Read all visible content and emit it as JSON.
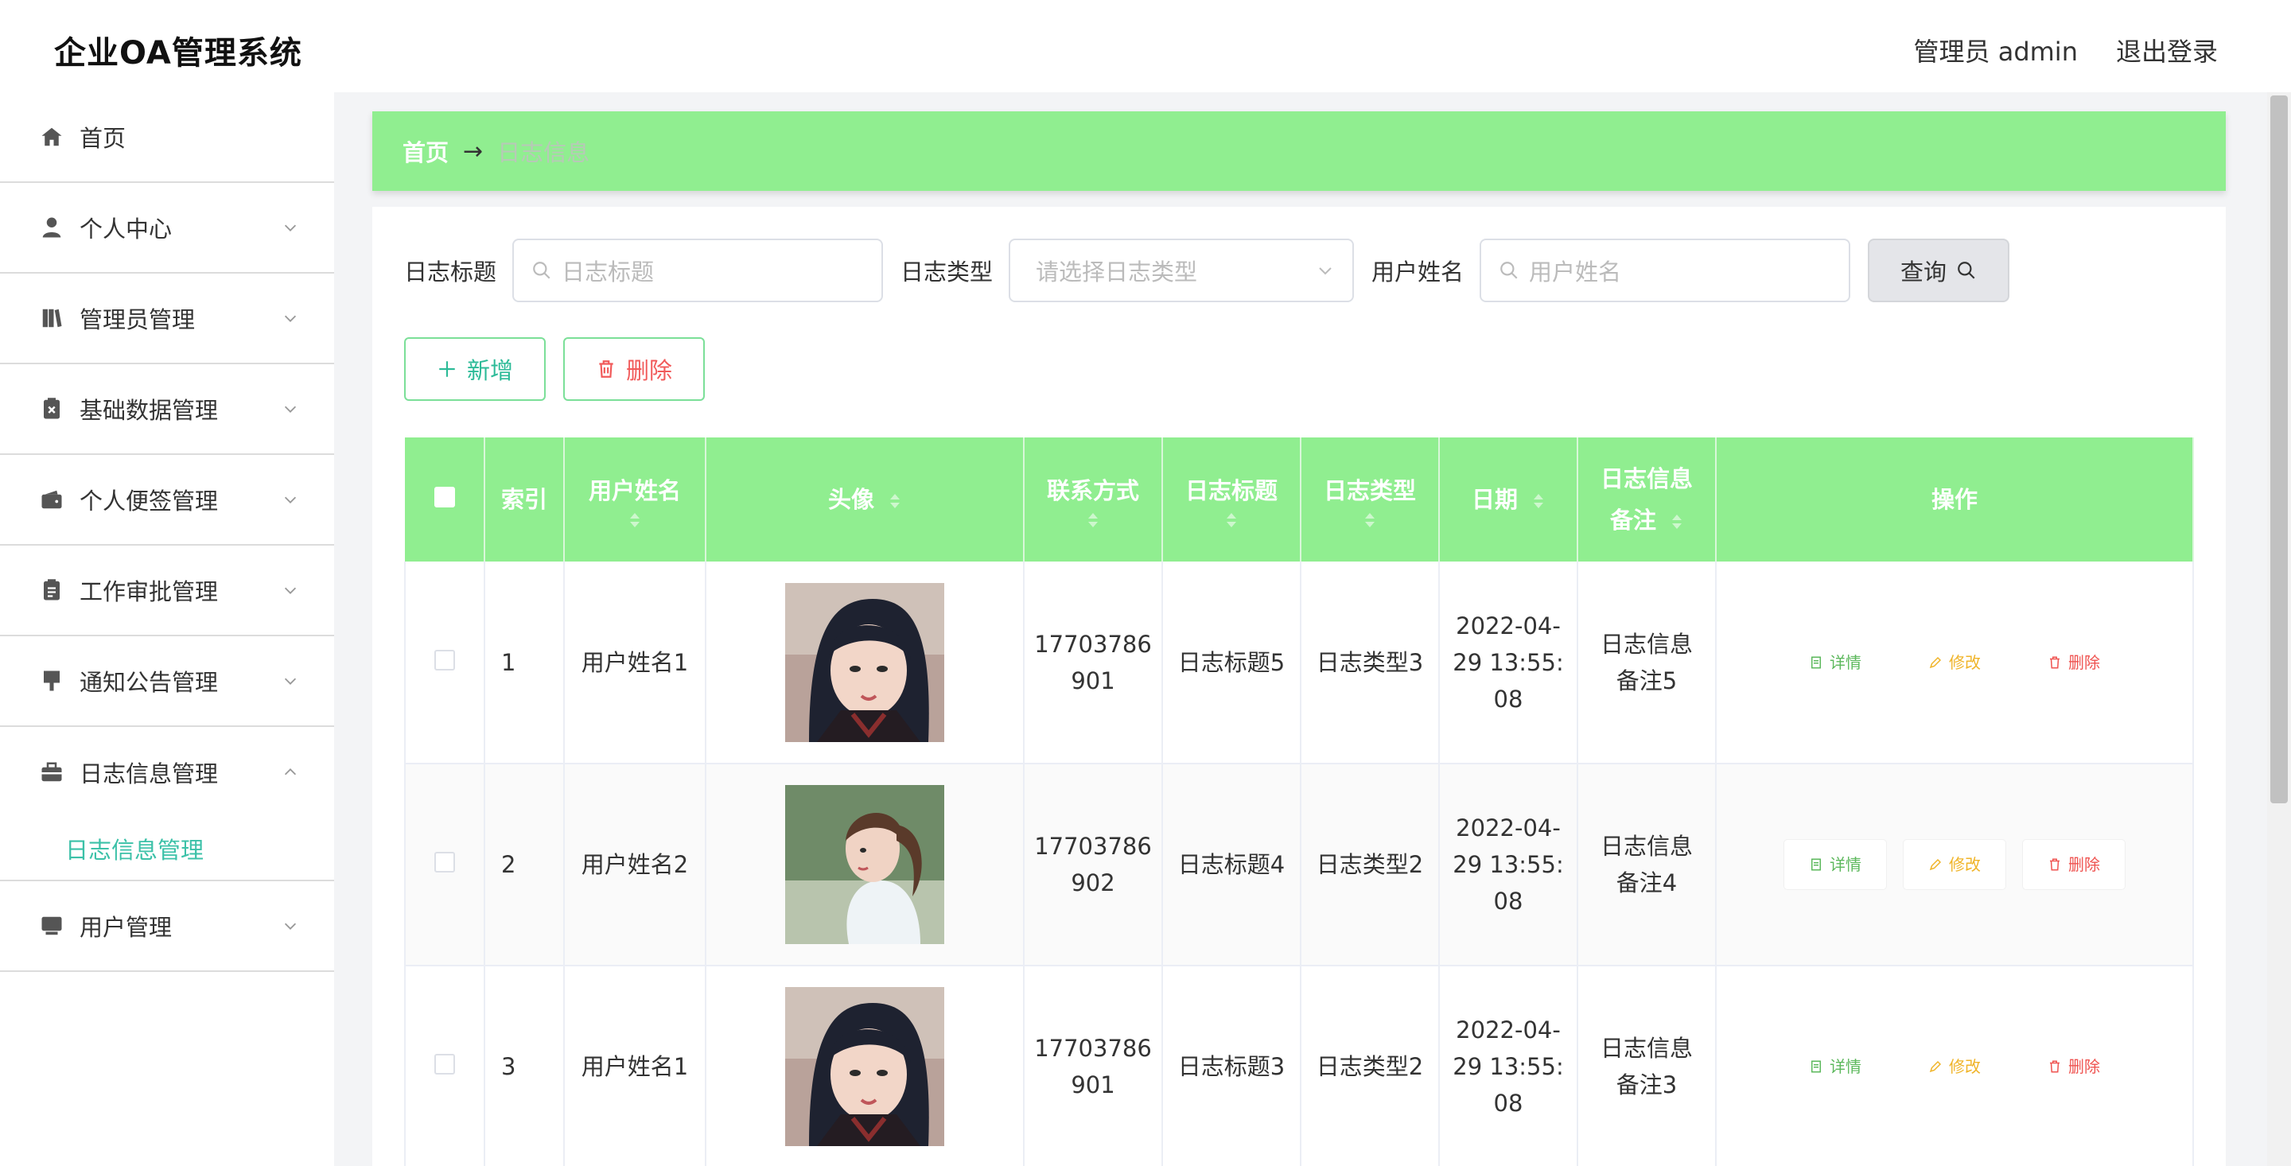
{
  "header": {
    "title": "企业OA管理系统",
    "user_label": "管理员 admin",
    "logout_label": "退出登录"
  },
  "sidebar": {
    "items": [
      {
        "label": "首页",
        "icon": "home-icon"
      },
      {
        "label": "个人中心",
        "icon": "user-icon"
      },
      {
        "label": "管理员管理",
        "icon": "book-icon"
      },
      {
        "label": "基础数据管理",
        "icon": "clipboard-x-icon"
      },
      {
        "label": "个人便签管理",
        "icon": "wallet-icon"
      },
      {
        "label": "工作审批管理",
        "icon": "document-icon"
      },
      {
        "label": "通知公告管理",
        "icon": "pin-icon"
      },
      {
        "label": "日志信息管理",
        "icon": "briefcase-icon"
      },
      {
        "label": "用户管理",
        "icon": "monitor-icon"
      }
    ],
    "active_sub": "日志信息管理",
    "accent_color": "#3cc1a8"
  },
  "breadcrumb": {
    "home": "首页",
    "arrow": "→",
    "current": "日志信息"
  },
  "search": {
    "title_label": "日志标题",
    "title_placeholder": "日志标题",
    "type_label": "日志类型",
    "type_placeholder": "请选择日志类型",
    "name_label": "用户姓名",
    "name_placeholder": "用户姓名",
    "query_label": "查询"
  },
  "actions": {
    "add_label": "新增",
    "delete_label": "删除"
  },
  "table": {
    "header_color": "#90ee90",
    "columns": {
      "index": "索引",
      "username": "用户姓名",
      "avatar": "头像",
      "contact": "联系方式",
      "log_title": "日志标题",
      "log_type": "日志类型",
      "date": "日期",
      "note_line1": "日志信息",
      "note_line2": "备注",
      "ops": "操作"
    },
    "rows": [
      {
        "index": "1",
        "username": "用户姓名1",
        "contact_a": "17703786",
        "contact_b": "901",
        "log_title": "日志标题5",
        "log_type": "日志类型3",
        "date_a": "2022-04-",
        "date_b": "29 13:55:",
        "date_c": "08",
        "note_a": "日志信息",
        "note_b": "备注5",
        "avatar": "short-hair-portrait"
      },
      {
        "index": "2",
        "username": "用户姓名2",
        "contact_a": "17703786",
        "contact_b": "902",
        "log_title": "日志标题4",
        "log_type": "日志类型2",
        "date_a": "2022-04-",
        "date_b": "29 13:55:",
        "date_c": "08",
        "note_a": "日志信息",
        "note_b": "备注4",
        "avatar": "ponytail-portrait"
      },
      {
        "index": "3",
        "username": "用户姓名1",
        "contact_a": "17703786",
        "contact_b": "901",
        "log_title": "日志标题3",
        "log_type": "日志类型2",
        "date_a": "2022-04-",
        "date_b": "29 13:55:",
        "date_c": "08",
        "note_a": "日志信息",
        "note_b": "备注3",
        "avatar": "short-hair-portrait"
      }
    ],
    "op_labels": {
      "detail": "详情",
      "edit": "修改",
      "delete": "删除"
    }
  }
}
